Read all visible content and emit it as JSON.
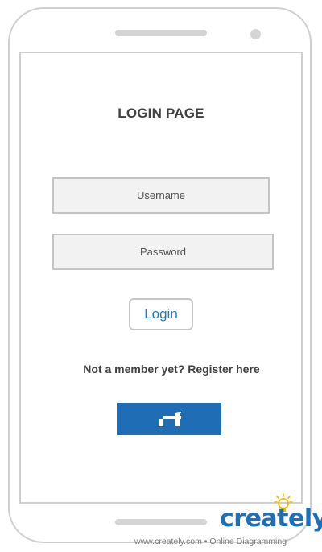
{
  "page": {
    "title": "LOGIN PAGE"
  },
  "form": {
    "username_placeholder": "Username",
    "password_placeholder": "Password",
    "login_label": "Login",
    "register_text": "Not a member yet? Register here",
    "facebook_icon": "facebook-f-icon"
  },
  "watermark": {
    "brand": "creately",
    "footer": "www.creately.com • Online Diagramming"
  },
  "colors": {
    "accent": "#1f78c8",
    "facebook": "#1f6db5",
    "brand": "#1d6fb8",
    "bulb": "#f5b800"
  }
}
